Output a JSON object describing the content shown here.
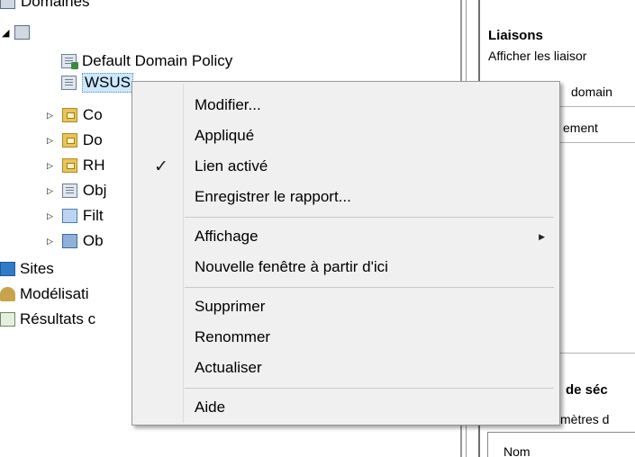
{
  "tree": {
    "domains_label": "Domaines",
    "default_policy": "Default Domain Policy",
    "wsus": "WSUS",
    "co_label": "Co",
    "do_label": "Do",
    "rh_label": "RH",
    "obj1_label": "Obj",
    "filt_label": "Filt",
    "obj2_label": "Ob",
    "sites": "Sites",
    "modelisation": "Modélisati",
    "resultats": "Résultats c"
  },
  "right_pane": {
    "liaisons_title": "Liaisons",
    "afficher_text": "Afficher les liaisor",
    "domain_text": "domain",
    "emplacement_text": "ement",
    "securite_title": "de séc",
    "parametres_text": "mètres d",
    "nom_header": "Nom"
  },
  "context_menu": {
    "items": [
      {
        "label": "Modifier...",
        "checked": false,
        "submenu": false
      },
      {
        "label": "Appliqué",
        "checked": false,
        "submenu": false
      },
      {
        "label": "Lien activé",
        "checked": true,
        "submenu": false
      },
      {
        "label": "Enregistrer le rapport...",
        "checked": false,
        "submenu": false
      },
      {
        "label": "Affichage",
        "checked": false,
        "submenu": true
      },
      {
        "label": "Nouvelle fenêtre à partir d'ici",
        "checked": false,
        "submenu": false
      },
      {
        "label": "Supprimer",
        "checked": false,
        "submenu": false
      },
      {
        "label": "Renommer",
        "checked": false,
        "submenu": false
      },
      {
        "label": "Actualiser",
        "checked": false,
        "submenu": false
      },
      {
        "label": "Aide",
        "checked": false,
        "submenu": false
      }
    ],
    "check_glyph": "✓",
    "submenu_glyph": "▶"
  }
}
